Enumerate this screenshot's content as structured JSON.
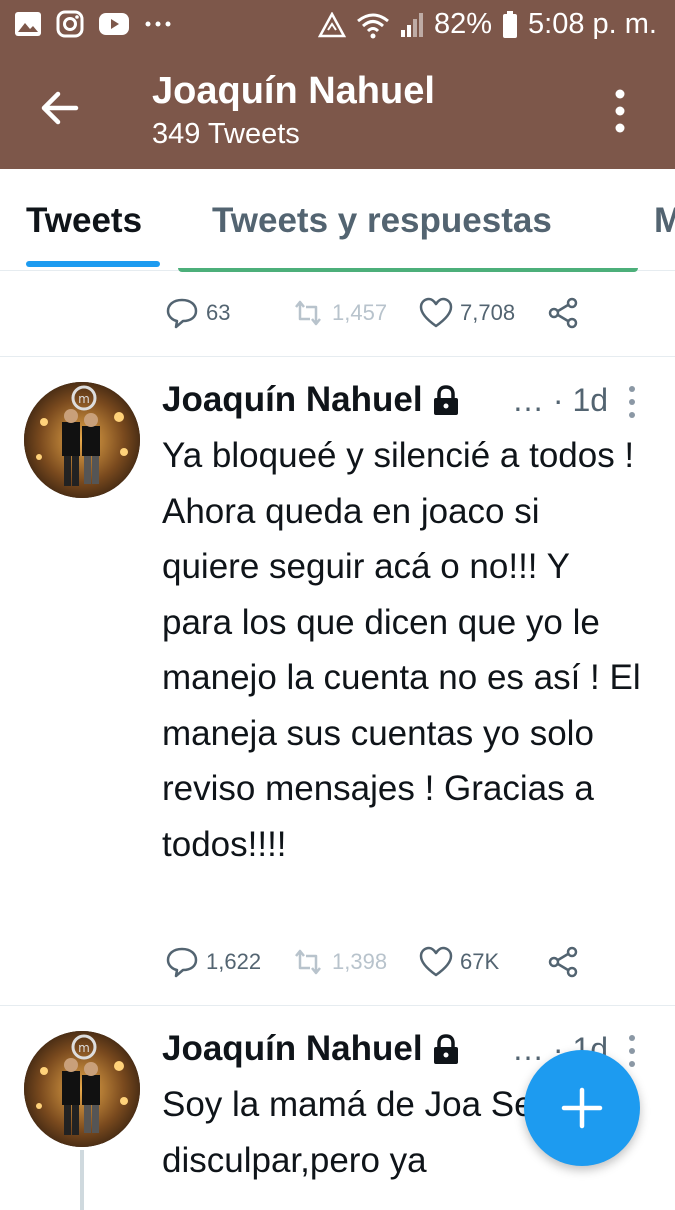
{
  "status_bar": {
    "battery": "82%",
    "time": "5:08 p. m.",
    "left_icons": [
      "gallery-icon",
      "instagram-icon",
      "youtube-icon",
      "more-notifications-icon"
    ],
    "right_icons": [
      "data-saver-icon",
      "wifi-icon",
      "signal-icon",
      "battery-icon"
    ]
  },
  "header": {
    "title": "Joaquín Nahuel",
    "subtitle": "349 Tweets"
  },
  "tabs": [
    {
      "label": "Tweets",
      "active": true
    },
    {
      "label": "Tweets y respuestas",
      "active": false
    },
    {
      "label": "M",
      "active": false
    }
  ],
  "previous_tweet": {
    "replies": "63",
    "retweets": "1,457",
    "likes": "7,708"
  },
  "tweets": [
    {
      "name": "Joaquín Nahuel",
      "handle_ellipsis": "…",
      "separator": "·",
      "time": "1d",
      "text": "Ya bloqueé y silencié a todos ! Ahora queda en joaco si quiere seguir acá o no!!! Y para los que dicen que yo le manejo la cuenta no es así ! El maneja sus cuentas yo solo reviso mensajes ! Gracias a todos!!!!",
      "replies": "1,622",
      "retweets": "1,398",
      "likes": "67K"
    },
    {
      "name": "Joaquín Nahuel",
      "handle_ellipsis": "…",
      "separator": "·",
      "time": "1d",
      "text_visible": "Soy la mamá de Joa Sepan disculpar,pero ya"
    }
  ],
  "colors": {
    "header_bg": "#7d574a",
    "accent": "#1d9bf0",
    "muted_text": "#536471"
  }
}
